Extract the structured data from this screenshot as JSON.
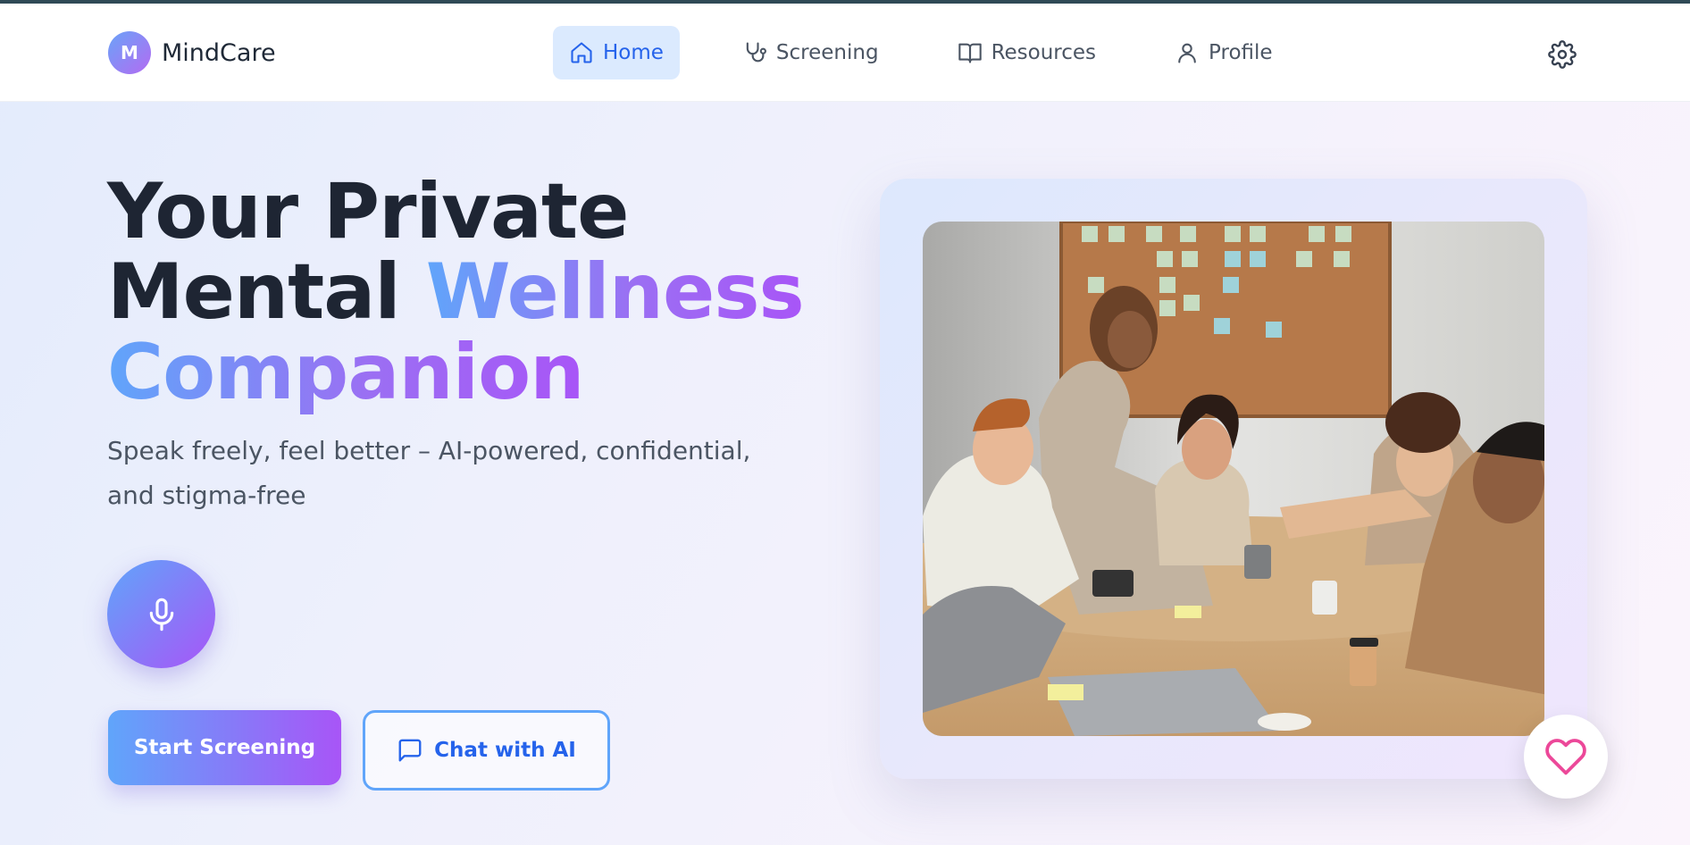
{
  "brand": {
    "logo_letter": "M",
    "name": "MindCare"
  },
  "nav": {
    "items": [
      {
        "label": "Home",
        "icon": "home-icon",
        "active": true
      },
      {
        "label": "Screening",
        "icon": "stethoscope-icon",
        "active": false
      },
      {
        "label": "Resources",
        "icon": "book-icon",
        "active": false
      },
      {
        "label": "Profile",
        "icon": "user-icon",
        "active": false
      }
    ],
    "settings_icon": "gear-icon"
  },
  "hero": {
    "title_line1": "Your Private",
    "title_line2_plain": "Mental ",
    "title_line2_accent": "Wellness",
    "title_line3_accent": "Companion",
    "subtitle": "Speak freely, feel better – AI-powered, confidential, and stigma-free",
    "mic_icon": "microphone-icon",
    "primary_button": "Start Screening",
    "secondary_button": "Chat with AI",
    "secondary_icon": "chat-bubble-icon"
  },
  "image_card": {
    "photo": "team-meeting-handshake-photo",
    "badge_icon": "heart-icon"
  },
  "colors": {
    "accent_blue": "#60a5fa",
    "accent_purple": "#a855f7",
    "active_nav_bg": "#dbeafe",
    "active_nav_text": "#2563eb",
    "heading": "#1e2533",
    "heart": "#ec4899"
  }
}
